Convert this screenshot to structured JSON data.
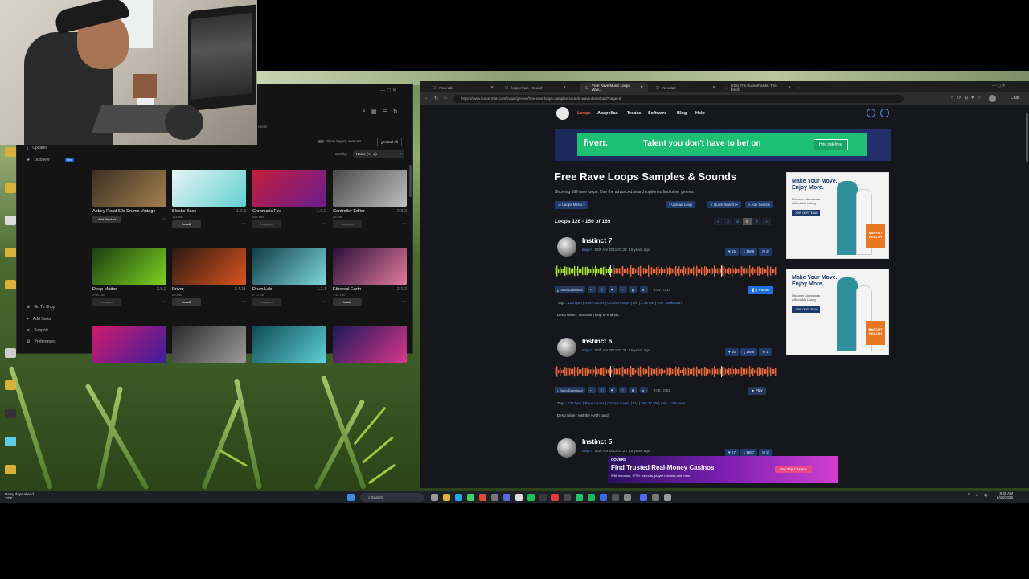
{
  "app": {
    "show_legacy": "Show legacy versions",
    "install_all": "Install All",
    "sort_label": "Sort by:",
    "sort_value": "Name (A - Z)",
    "partial_text": "rands",
    "sidebar_top": [
      {
        "label": "Updates",
        "icon": "refresh-icon"
      },
      {
        "label": "Discover",
        "icon": "star-icon",
        "badge": "New"
      }
    ],
    "sidebar_bottom": [
      {
        "label": "Go To Shop",
        "icon": "cart-icon"
      },
      {
        "label": "Add Serial",
        "icon": "plus-icon"
      },
      {
        "label": "Support",
        "icon": "tools-icon"
      },
      {
        "label": "Preferences",
        "icon": "gear-icon"
      }
    ],
    "tiles": [
      {
        "name": "Abbey Road 60s Drums Vintage",
        "version": "",
        "size": "",
        "action": "Add Product",
        "dim": false,
        "color1": "#3b2f22",
        "color2": "#a4804f"
      },
      {
        "name": "Blocks Base",
        "version": "1.0.3",
        "size": "114 MB",
        "action": "Install",
        "dim": false,
        "color1": "#e9f3f6",
        "color2": "#5fd1cf"
      },
      {
        "name": "Chromatic Fire",
        "version": "1.0.2",
        "size": "498 MB",
        "action": "Installed",
        "dim": true,
        "color1": "#c41e3a",
        "color2": "#6a1c8e"
      },
      {
        "name": "Controller Editor",
        "version": "2.8.2",
        "size": "59 MB",
        "action": "Installed",
        "dim": true,
        "color1": "#4a4a4a",
        "color2": "#bfbfbf"
      },
      {
        "name": "Deep Matter",
        "version": "2.8.2",
        "size": "2.04 GB",
        "action": "Installed",
        "dim": true,
        "color1": "#1a3d10",
        "color2": "#7ed321"
      },
      {
        "name": "Driver",
        "version": "1.4.11",
        "size": "28 MB",
        "action": "Install",
        "dim": false,
        "color1": "#2a1a12",
        "color2": "#d9541e"
      },
      {
        "name": "Drum Lab",
        "version": "1.2.1",
        "size": "2.72 GB",
        "action": "Installed",
        "dim": true,
        "color1": "#0e3c44",
        "color2": "#7fd6dd"
      },
      {
        "name": "Ethereal Earth",
        "version": "2.1.2",
        "size": "1.41 GB",
        "action": "Install",
        "dim": false,
        "color1": "#2a0f3a",
        "color2": "#e17a9a"
      },
      {
        "name": "",
        "version": "",
        "size": "",
        "action": "",
        "dim": false,
        "color1": "#d21a6b",
        "color2": "#3a1f9e"
      },
      {
        "name": "",
        "version": "",
        "size": "",
        "action": "",
        "dim": false,
        "color1": "#2a2a2a",
        "color2": "#9a9a9a"
      },
      {
        "name": "",
        "version": "",
        "size": "",
        "action": "",
        "dim": false,
        "color1": "#0d4a52",
        "color2": "#5ed0d8"
      },
      {
        "name": "",
        "version": "",
        "size": "",
        "action": "",
        "dim": false,
        "color1": "#1a1a5a",
        "color2": "#d9368a"
      }
    ]
  },
  "browser": {
    "tabs": [
      {
        "label": "New tab",
        "active": false
      },
      {
        "label": "looperman - Search",
        "active": false
      },
      {
        "label": "Free Rave Music Loops Wav...",
        "active": true
      },
      {
        "label": "New tab",
        "active": false
      },
      {
        "label": "(225) The Buckethoads: The Bomb",
        "active": false
      }
    ],
    "url": "https://www.looperman.com/loops/genres/free-rave-loops-samples-sounds-wavs-download?page=6",
    "profile": "Chat"
  },
  "site": {
    "nav": [
      "Loops",
      "Acapellas",
      "Tracks",
      "Software",
      "Blog",
      "Help"
    ],
    "ad": {
      "brand": "fiverr.",
      "text": "Talent you don't have to bet on",
      "cta": "Hire risk-free"
    },
    "title": "Free Rave Loops Samples & Sounds",
    "subtitle": "Showing 169 rave loops. Use the advanced search option to find other genres.",
    "buttons": {
      "loops_menu": "Loops Menu",
      "upload": "Upload Loop",
      "quick_search": "Quick Search",
      "adv_search": "Adv Search"
    },
    "range": "Loops 126 - 150 of 169",
    "pages": [
      "«",
      "4",
      "5",
      "6",
      "7",
      "»"
    ],
    "current_page": "6",
    "loops": [
      {
        "title": "Instinct 7",
        "user": "Edge7",
        "date": "10th Apr 2011 03:22",
        "ago": "15 years ago",
        "likes": "15",
        "downloads": "1669",
        "comments": "2",
        "time": "0:04 / 0:14",
        "play": "Pause",
        "tags_prefix": "Tags :",
        "bpm": "135 bpm",
        "cat1": "Rave Loops",
        "cat2": "Groove Loops",
        "sig": "4/4",
        "size": "2.39 MB",
        "key": "Key : Unknown",
        "description": "Description : Transition loop to end set.",
        "goto": "Go to Download"
      },
      {
        "title": "Instinct 6",
        "user": "Edge7",
        "date": "10th Apr 2011 03:21",
        "ago": "15 years ago",
        "likes": "16",
        "downloads": "1488",
        "comments": "1",
        "time": "0:00 / 0:02",
        "play": "Play",
        "tags_prefix": "Tags :",
        "bpm": "135 bpm",
        "cat1": "Rave Loops",
        "cat2": "Groove Loops",
        "sig": "4/4",
        "size": "306.37 KB",
        "key": "Key : Unknown",
        "description": "Description : just the synth patch",
        "goto": "Go to Download"
      },
      {
        "title": "Instinct 5",
        "user": "Edge7",
        "date": "10th Apr 2011 03:20",
        "ago": "15 years ago",
        "likes": "17",
        "downloads": "1657",
        "comments": "2"
      }
    ],
    "side_ads": [
      {
        "headline": "Make Your Move. Enjoy More.",
        "body": "Discover Alabama's Affordable Living",
        "cta": "JOIN OUR TEAM",
        "brand": "BAPTIST HEALTH"
      },
      {
        "headline": "Make Your Move. Enjoy More.",
        "body": "Discover Alabama's Affordable Living",
        "cta": "JOIN OUR TEAM",
        "brand": "BAPTIST HEALTH"
      }
    ],
    "bottom_ad": {
      "brand": "COVERS",
      "headline": "Find Trusted Real-Money Casinos",
      "sub": "With bonuses, 97%+ payouts, player rewards and more",
      "cta": "See Top Casinos"
    }
  },
  "taskbar": {
    "weather": "Rainy days ahead",
    "temp": "70°F",
    "search": "Search",
    "time": "9:36 AM",
    "date": "6/18/2026"
  },
  "colors": {
    "accent": "#e8673c",
    "link": "#5a8fd8",
    "wave_orange": "#e8673c",
    "wave_green": "#a7e22e"
  }
}
